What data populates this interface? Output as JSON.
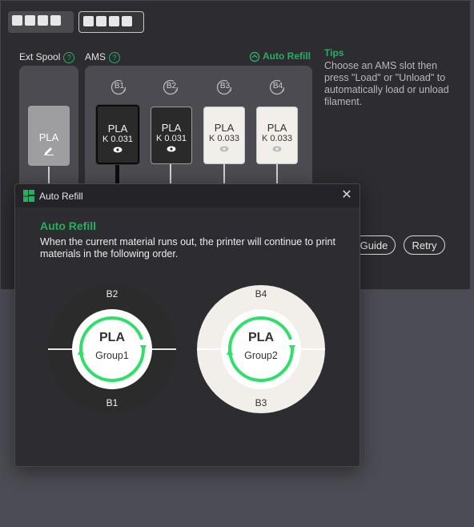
{
  "tabs": {
    "group1_count": 4,
    "group2_count": 4
  },
  "labels": {
    "ext_spool": "Ext Spool",
    "ams": "AMS",
    "help": "?",
    "auto_refill_link": "Auto Refill"
  },
  "ext_spool": {
    "material": "PLA",
    "icon": "edit-icon"
  },
  "ams_slots": [
    {
      "id": "B1",
      "material": "PLA",
      "k": "K 0.031",
      "theme": "dark",
      "selected": true,
      "icon": "eye-icon"
    },
    {
      "id": "B2",
      "material": "PLA",
      "k": "K 0.031",
      "theme": "dark",
      "selected": false,
      "icon": "eye-icon"
    },
    {
      "id": "B3",
      "material": "PLA",
      "k": "K 0.033",
      "theme": "light",
      "selected": false,
      "icon": "eye-icon"
    },
    {
      "id": "B4",
      "material": "PLA",
      "k": "K 0.033",
      "theme": "light",
      "selected": false,
      "icon": "eye-icon"
    }
  ],
  "tips": {
    "title": "Tips",
    "text": "Choose an AMS slot then press \"Load\" or \"Unload\" to automatically load or unload filament."
  },
  "buttons": {
    "guide": "Guide",
    "retry": "Retry"
  },
  "dialog": {
    "title": "Auto Refill",
    "heading": "Auto Refill",
    "description": "When the current material runs out, the printer will continue to print materials in the following order.",
    "close_icon": "close-icon",
    "groups": [
      {
        "material": "PLA",
        "name": "Group1",
        "top": "B2",
        "bottom": "B1",
        "theme": "dark"
      },
      {
        "material": "PLA",
        "name": "Group2",
        "top": "B4",
        "bottom": "B3",
        "theme": "light"
      }
    ]
  },
  "colors": {
    "accent": "#27ae60",
    "panel": "#2d2d31",
    "dark_spool": "#2a2a2a",
    "light_spool": "#f2eeea"
  }
}
